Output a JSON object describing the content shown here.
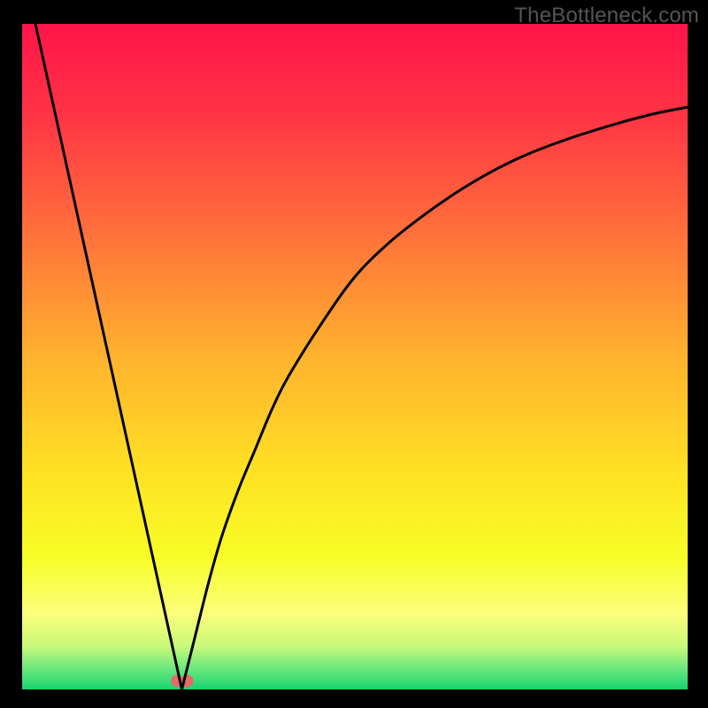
{
  "watermark": "TheBottleneck.com",
  "chart_data": {
    "type": "line",
    "title": "",
    "xlabel": "",
    "ylabel": "",
    "xlim": [
      0,
      100
    ],
    "ylim": [
      0,
      100
    ],
    "series": [
      {
        "name": "left-branch",
        "x": [
          2,
          24
        ],
        "y": [
          100,
          0
        ]
      },
      {
        "name": "right-branch",
        "x": [
          24,
          26,
          28,
          30,
          32.5,
          35,
          37.5,
          40,
          45,
          50,
          55,
          60,
          65,
          70,
          75,
          80,
          85,
          90,
          95,
          100
        ],
        "y": [
          0,
          8,
          16,
          23,
          30,
          36,
          42,
          47,
          55,
          62,
          67,
          71,
          74.5,
          77.5,
          80,
          82,
          83.7,
          85.2,
          86.5,
          87.5
        ]
      }
    ],
    "markers": [
      {
        "name": "minimum-marker-a",
        "x": 23.3,
        "y": 1.3,
        "color": "#E76A6A",
        "r": 7
      },
      {
        "name": "minimum-marker-b",
        "x": 24.8,
        "y": 1.3,
        "color": "#E76A6A",
        "r": 7
      }
    ],
    "gradient_stops": [
      {
        "offset": 0.0,
        "color": "#FF1449"
      },
      {
        "offset": 0.14,
        "color": "#FF3545"
      },
      {
        "offset": 0.3,
        "color": "#FF6C3C"
      },
      {
        "offset": 0.5,
        "color": "#FFB22E"
      },
      {
        "offset": 0.68,
        "color": "#FFE324"
      },
      {
        "offset": 0.8,
        "color": "#F7FD26"
      },
      {
        "offset": 0.885,
        "color": "#FCFF7B"
      },
      {
        "offset": 0.935,
        "color": "#C9F97A"
      },
      {
        "offset": 0.97,
        "color": "#68E77E"
      },
      {
        "offset": 1.0,
        "color": "#18D36F"
      }
    ]
  }
}
